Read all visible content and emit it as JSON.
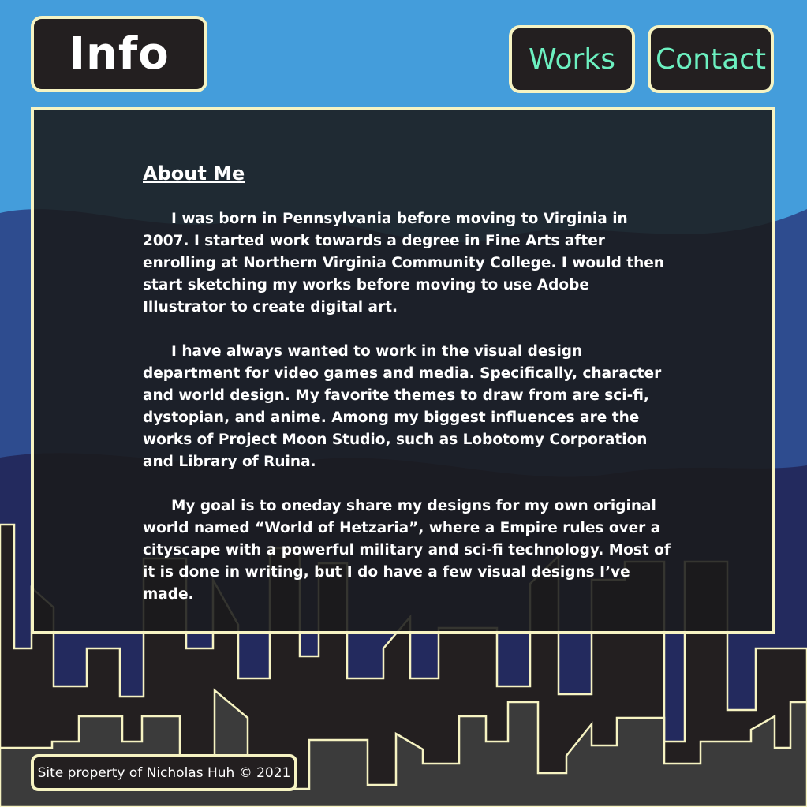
{
  "header": {
    "logo_label": "Info",
    "nav": {
      "works_label": "Works",
      "contact_label": "Contact"
    }
  },
  "main": {
    "heading": "About Me",
    "paragraphs": [
      "I was born in Pennsylvania before moving to Virginia in 2007. I started work towards a degree in Fine Arts after enrolling at Northern Virginia Community College. I would then start sketching my works before moving to use Adobe Illustrator to create digital art.",
      "I have always wanted to work in the visual design department for video games and media. Specifically, character and world design. My favorite themes to draw from are sci-fi, dystopian, and anime. Among my biggest influences are the works of Project Moon Studio, such as Lobotomy Corporation and Library of Ruina.",
      "My goal is to oneday share my designs for my own original world named “World of Hetzaria”, where a Empire rules over a cityscape with a powerful military and sci-fi technology. Most of it is done in writing, but I do have a few visual designs I’ve made."
    ]
  },
  "footer": {
    "text": "Site property of Nicholas Huh © 2021"
  },
  "colors": {
    "sky": "#449ddb",
    "hills_mid": "#2e4c8f",
    "hills_deep": "#232a5e",
    "buildings_back": "#231f20",
    "buildings_front": "#3b3b3b",
    "outline": "#f6f3c2",
    "accent": "#6cf0c0",
    "panel": "#1a1a1b"
  }
}
